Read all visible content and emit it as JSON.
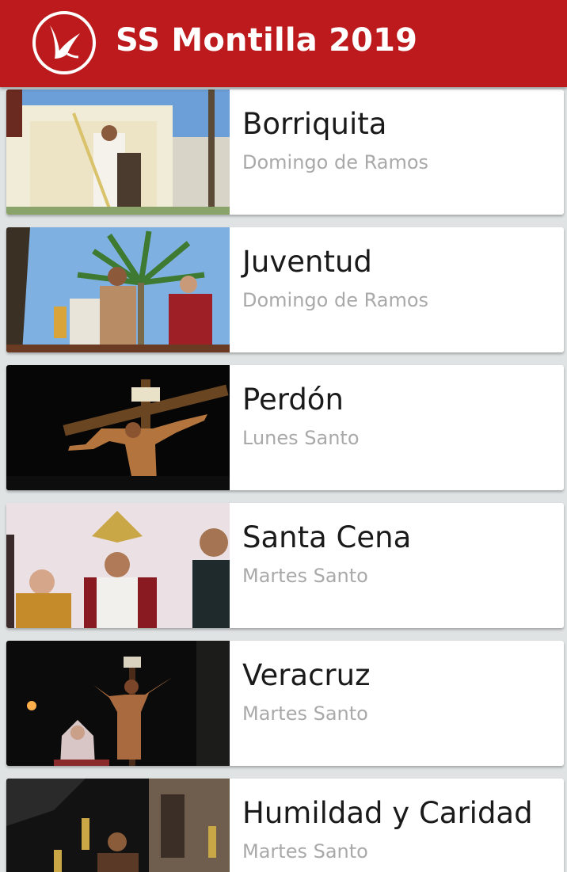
{
  "app": {
    "title": "SS Montilla 2019",
    "logo_icon": "dove-logo-icon",
    "accent_color": "#bd1a1d"
  },
  "items": [
    {
      "title": "Borriquita",
      "subtitle": "Domingo de Ramos",
      "image": "procession-photo-borriquita"
    },
    {
      "title": "Juventud",
      "subtitle": "Domingo de Ramos",
      "image": "procession-photo-juventud"
    },
    {
      "title": "Perdón",
      "subtitle": "Lunes Santo",
      "image": "procession-photo-perdon"
    },
    {
      "title": "Santa Cena",
      "subtitle": "Martes Santo",
      "image": "procession-photo-santa-cena"
    },
    {
      "title": "Veracruz",
      "subtitle": "Martes Santo",
      "image": "procession-photo-veracruz"
    },
    {
      "title": "Humildad y Caridad",
      "subtitle": "Martes Santo",
      "image": "procession-photo-humildad"
    }
  ]
}
